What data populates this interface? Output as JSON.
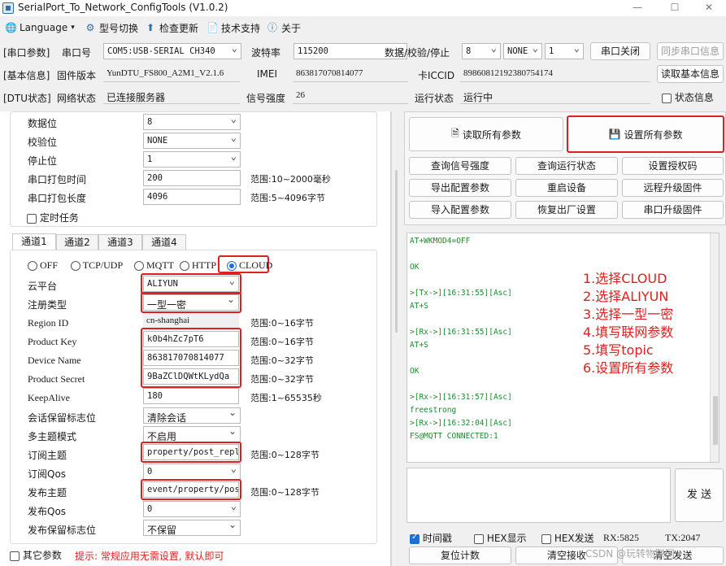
{
  "window": {
    "title": "SerialPort_To_Network_ConfigTools (V1.0.2)",
    "min_icon": "minimize-icon",
    "max_icon": "maximize-icon",
    "close_icon": "close-icon"
  },
  "toolbar": {
    "language": "Language",
    "model_switch": "型号切换",
    "check_update": "检查更新",
    "tech_support": "技术支持",
    "about": "关于"
  },
  "serial_row": {
    "section": "[串口参数]",
    "port_label": "串口号",
    "port_value": "COM5:USB-SERIAL CH340",
    "baud_label": "波特率",
    "baud_value": "115200",
    "dps_label": "数据/校验/停止",
    "data_bits": "8",
    "parity": "NONE",
    "stop_bits": "1",
    "close_btn": "串口关闭",
    "sync_btn": "同步串口信息"
  },
  "basic_row": {
    "section": "[基本信息]",
    "fw_label": "固件版本",
    "fw_value": "YunDTU_FS800_A2M1_V2.1.6",
    "imei_label": "IMEI",
    "imei_value": "863817070814077",
    "iccid_label": "卡ICCID",
    "iccid_value": "89860812192380754174",
    "read_btn": "读取基本信息"
  },
  "dtu_row": {
    "section": "[DTU状态]",
    "net_label": "网络状态",
    "net_value": "已连接服务器",
    "signal_label": "信号强度",
    "signal_value": "26",
    "run_label": "运行状态",
    "run_value": "运行中",
    "status_cb": "状态信息"
  },
  "serial_params": {
    "data_bits_label": "数据位",
    "data_bits": "8",
    "parity_label": "校验位",
    "parity": "NONE",
    "stop_label": "停止位",
    "stop": "1",
    "pack_time_label": "串口打包时间",
    "pack_time": "200",
    "pack_time_range": "范围:10~2000毫秒",
    "pack_len_label": "串口打包长度",
    "pack_len": "4096",
    "pack_len_range": "范围:5~4096字节",
    "timer_task": "定时任务"
  },
  "channel_tabs": [
    "通道1",
    "通道2",
    "通道3",
    "通道4"
  ],
  "modes": [
    "OFF",
    "TCP/UDP",
    "MQTT",
    "HTTP",
    "CLOUD"
  ],
  "cloud": {
    "platform_label": "云平台",
    "platform": "ALIYUN",
    "reg_label": "注册类型",
    "reg": "一型一密",
    "region_label": "Region ID",
    "region": "cn-shanghai",
    "region_range": "范围:0~16字节",
    "pk_label": "Product Key",
    "pk": "k0b4hZc7pT6",
    "pk_range": "范围:0~16字节",
    "dn_label": "Device Name",
    "dn": "863817070814077",
    "dn_range": "范围:0~32字节",
    "ps_label": "Product Secret",
    "ps": "9BaZClDQWtKLydQa",
    "ps_range": "范围:0~32字节",
    "ka_label": "KeepAlive",
    "ka": "180",
    "ka_range": "范围:1~65535秒",
    "session_label": "会话保留标志位",
    "session": "清除会话",
    "multi_label": "多主题模式",
    "multi": "不启用",
    "sub_label": "订阅主题",
    "sub": "property/post_reply",
    "sub_range": "范围:0~128字节",
    "subqos_label": "订阅Qos",
    "subqos": "0",
    "pub_label": "发布主题",
    "pub": "event/property/post",
    "pub_range": "范围:0~128字节",
    "pubqos_label": "发布Qos",
    "pubqos": "0",
    "retain_label": "发布保留标志位",
    "retain": "不保留"
  },
  "bottom_left": {
    "other_params": "其它参数",
    "hint": "提示: 常规应用无需设置, 默认即可"
  },
  "right": {
    "read_all": "读取所有参数",
    "set_all": "设置所有参数",
    "grid": [
      [
        "查询信号强度",
        "查询运行状态",
        "设置授权码"
      ],
      [
        "导出配置参数",
        "重启设备",
        "远程升级固件"
      ],
      [
        "导入配置参数",
        "恢复出厂设置",
        "串口升级固件"
      ]
    ]
  },
  "console_lines": [
    "AT+WKMOD4=OFF",
    "",
    "OK",
    "",
    ">[Tx->][16:31:55][Asc]",
    "AT+S",
    "",
    ">[Rx->][16:31:55][Asc]",
    "AT+S",
    "",
    "OK",
    "",
    ">[Rx->][16:31:57][Asc]",
    "freestrong",
    ">[Rx->][16:32:04][Asc]",
    "FS@MQTT CONNECTED:1"
  ],
  "annotations": [
    "1.选择CLOUD",
    "2.选择ALIYUN",
    "3.选择一型一密",
    "4.填写联网参数",
    "5.填写topic",
    "6.设置所有参数"
  ],
  "send": {
    "send_btn": "发 送"
  },
  "status_bar": {
    "timestamp": "时间戳",
    "hex_show": "HEX显示",
    "hex_send": "HEX发送",
    "rx": "RX:5825",
    "tx": "TX:2047",
    "reset_count": "复位计数",
    "clear_recv": "清空接收",
    "clear_send": "清空发送"
  },
  "watermark": "CSDN @玩转物联网",
  "colors": {
    "accent": "#1f6fd1",
    "highlight": "#e02020",
    "console_text": "#1e8a2e"
  }
}
